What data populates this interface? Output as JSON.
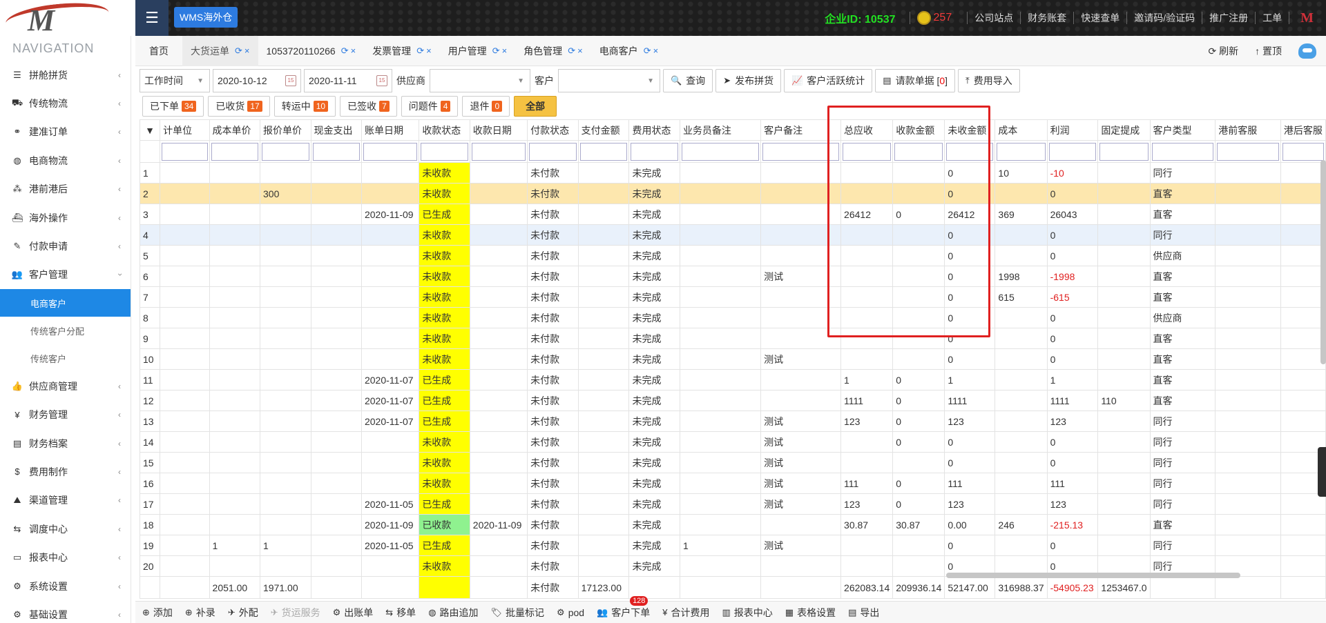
{
  "header": {
    "wms_label": "WMS海外仓",
    "enterprise_label": "企业ID: 10537",
    "coins": "257",
    "links": [
      "公司站点",
      "财务账套",
      "快速查单",
      "邀请码/验证码",
      "推广注册",
      "工单"
    ]
  },
  "sidebar": {
    "title": "NAVIGATION",
    "items": [
      {
        "label": "拼舱拼货",
        "icon": "list-icon"
      },
      {
        "label": "传统物流",
        "icon": "truck-icon"
      },
      {
        "label": "建准订单",
        "icon": "link-icon"
      },
      {
        "label": "电商物流",
        "icon": "globe-icon"
      },
      {
        "label": "港前港后",
        "icon": "cubes-icon"
      },
      {
        "label": "海外操作",
        "icon": "ship-icon"
      },
      {
        "label": "付款申请",
        "icon": "pen-icon"
      },
      {
        "label": "客户管理",
        "icon": "users-icon"
      }
    ],
    "sub_items": [
      "电商客户",
      "传统客户分配",
      "传统客户"
    ],
    "items_after": [
      {
        "label": "供应商管理",
        "icon": "thumb-icon"
      },
      {
        "label": "财务管理",
        "icon": "yen-icon"
      },
      {
        "label": "财务档案",
        "icon": "book-icon"
      },
      {
        "label": "费用制作",
        "icon": "dollar-icon"
      },
      {
        "label": "渠道管理",
        "icon": "road-icon"
      },
      {
        "label": "调度中心",
        "icon": "retweet-icon"
      },
      {
        "label": "报表中心",
        "icon": "file-icon"
      },
      {
        "label": "系统设置",
        "icon": "gear-icon"
      },
      {
        "label": "基础设置",
        "icon": "gear-icon"
      }
    ]
  },
  "tabs": {
    "home": "首页",
    "items": [
      "大货运单",
      "1053720110266",
      "发票管理",
      "用户管理",
      "角色管理",
      "电商客户"
    ],
    "refresh": "刷新",
    "pin": "置顶"
  },
  "toolbar": {
    "time_type": "工作时间",
    "date_from": "2020-10-12",
    "date_to": "2020-11-11",
    "supplier_label": "供应商",
    "customer_label": "客户",
    "query": "查询",
    "publish": "发布拼货",
    "stats": "客户活跃统计",
    "invoice": "请款单据",
    "invoice_count": "0",
    "fee_import": "费用导入"
  },
  "filters": [
    {
      "label": "已下单",
      "count": "34"
    },
    {
      "label": "已收货",
      "count": "17"
    },
    {
      "label": "转运中",
      "count": "10"
    },
    {
      "label": "已签收",
      "count": "7"
    },
    {
      "label": "问题件",
      "count": "4"
    },
    {
      "label": "退件",
      "count": "0"
    }
  ],
  "filter_all": "全部",
  "table": {
    "columns": [
      "计单位",
      "成本单价",
      "报价单价",
      "现金支出",
      "账单日期",
      "收款状态",
      "收款日期",
      "付款状态",
      "支付金额",
      "费用状态",
      "业务员备注",
      "客户备注",
      "总应收",
      "收款金额",
      "未收金额",
      "成本",
      "利润",
      "固定提成",
      "客户类型",
      "港前客服",
      "港后客服"
    ],
    "rows": [
      [
        "",
        "",
        "",
        "",
        "",
        "未收款",
        "",
        "未付款",
        "",
        "未完成",
        "",
        "",
        "",
        "",
        "0",
        "10",
        "-10",
        "",
        "同行",
        "",
        ""
      ],
      [
        "",
        "",
        "300",
        "",
        "",
        "未收款",
        "",
        "未付款",
        "",
        "未完成",
        "",
        "",
        "",
        "",
        "0",
        "",
        "0",
        "",
        "直客",
        "",
        ""
      ],
      [
        "",
        "",
        "",
        "",
        "2020-11-09",
        "已生成",
        "",
        "未付款",
        "",
        "未完成",
        "",
        "",
        "26412",
        "0",
        "26412",
        "369",
        "26043",
        "",
        "直客",
        "",
        ""
      ],
      [
        "",
        "",
        "",
        "",
        "",
        "未收款",
        "",
        "未付款",
        "",
        "未完成",
        "",
        "",
        "",
        "",
        "0",
        "",
        "0",
        "",
        "同行",
        "",
        ""
      ],
      [
        "",
        "",
        "",
        "",
        "",
        "未收款",
        "",
        "未付款",
        "",
        "未完成",
        "",
        "",
        "",
        "",
        "0",
        "",
        "0",
        "",
        "供应商",
        "",
        ""
      ],
      [
        "",
        "",
        "",
        "",
        "",
        "未收款",
        "",
        "未付款",
        "",
        "未完成",
        "",
        "测试",
        "",
        "",
        "0",
        "1998",
        "-1998",
        "",
        "直客",
        "",
        ""
      ],
      [
        "",
        "",
        "",
        "",
        "",
        "未收款",
        "",
        "未付款",
        "",
        "未完成",
        "",
        "",
        "",
        "",
        "0",
        "615",
        "-615",
        "",
        "直客",
        "",
        ""
      ],
      [
        "",
        "",
        "",
        "",
        "",
        "未收款",
        "",
        "未付款",
        "",
        "未完成",
        "",
        "",
        "",
        "",
        "0",
        "",
        "0",
        "",
        "供应商",
        "",
        ""
      ],
      [
        "",
        "",
        "",
        "",
        "",
        "未收款",
        "",
        "未付款",
        "",
        "未完成",
        "",
        "",
        "",
        "",
        "0",
        "",
        "0",
        "",
        "直客",
        "",
        ""
      ],
      [
        "",
        "",
        "",
        "",
        "",
        "未收款",
        "",
        "未付款",
        "",
        "未完成",
        "",
        "测试",
        "",
        "",
        "0",
        "",
        "0",
        "",
        "直客",
        "",
        ""
      ],
      [
        "",
        "",
        "",
        "",
        "2020-11-07",
        "已生成",
        "",
        "未付款",
        "",
        "未完成",
        "",
        "",
        "1",
        "0",
        "1",
        "",
        "1",
        "",
        "直客",
        "",
        ""
      ],
      [
        "",
        "",
        "",
        "",
        "2020-11-07",
        "已生成",
        "",
        "未付款",
        "",
        "未完成",
        "",
        "",
        "1111",
        "0",
        "1111",
        "",
        "1111",
        "110",
        "直客",
        "",
        ""
      ],
      [
        "",
        "",
        "",
        "",
        "2020-11-07",
        "已生成",
        "",
        "未付款",
        "",
        "未完成",
        "",
        "测试",
        "123",
        "0",
        "123",
        "",
        "123",
        "",
        "同行",
        "",
        ""
      ],
      [
        "",
        "",
        "",
        "",
        "",
        "未收款",
        "",
        "未付款",
        "",
        "未完成",
        "",
        "测试",
        "",
        "0",
        "0",
        "",
        "0",
        "",
        "同行",
        "",
        ""
      ],
      [
        "",
        "",
        "",
        "",
        "",
        "未收款",
        "",
        "未付款",
        "",
        "未完成",
        "",
        "测试",
        "",
        "",
        "0",
        "",
        "0",
        "",
        "同行",
        "",
        ""
      ],
      [
        "",
        "",
        "",
        "",
        "",
        "未收款",
        "",
        "未付款",
        "",
        "未完成",
        "",
        "测试",
        "111",
        "0",
        "111",
        "",
        "111",
        "",
        "同行",
        "",
        ""
      ],
      [
        "",
        "",
        "",
        "",
        "2020-11-05",
        "已生成",
        "",
        "未付款",
        "",
        "未完成",
        "",
        "测试",
        "123",
        "0",
        "123",
        "",
        "123",
        "",
        "同行",
        "",
        ""
      ],
      [
        "",
        "",
        "",
        "",
        "2020-11-09",
        "已收款",
        "2020-11-09",
        "未付款",
        "",
        "未完成",
        "",
        "",
        "30.87",
        "30.87",
        "0.00",
        "246",
        "-215.13",
        "",
        "直客",
        "",
        ""
      ],
      [
        "",
        "1",
        "1",
        "",
        "2020-11-05",
        "已生成",
        "",
        "未付款",
        "",
        "未完成",
        "1",
        "测试",
        "",
        "",
        "0",
        "",
        "0",
        "",
        "同行",
        "",
        ""
      ],
      [
        "",
        "",
        "",
        "",
        "",
        "未收款",
        "",
        "未付款",
        "",
        "未完成",
        "",
        "",
        "",
        "",
        "0",
        "",
        "0",
        "",
        "同行",
        "",
        ""
      ]
    ],
    "summary": [
      "",
      "2051.00",
      "1971.00",
      "",
      "",
      "",
      "",
      "未付款",
      "17123.00",
      "",
      "",
      "",
      "262083.14",
      "209936.14",
      "52147.00",
      "316988.37",
      "-54905.23",
      "1253467.0",
      "",
      "",
      ""
    ]
  },
  "bottom": {
    "items": [
      {
        "label": "添加",
        "icon": "plus-circle-icon"
      },
      {
        "label": "补录",
        "icon": "plus-circle-icon"
      },
      {
        "label": "外配",
        "icon": "plane-icon"
      },
      {
        "label": "货运服务",
        "icon": "plane-icon",
        "disabled": true
      },
      {
        "label": "出账单",
        "icon": "gear-icon"
      },
      {
        "label": "移单",
        "icon": "retweet-icon"
      },
      {
        "label": "路由追加",
        "icon": "globe-icon"
      },
      {
        "label": "批量标记",
        "icon": "tag-icon"
      },
      {
        "label": "pod",
        "icon": "gear-icon"
      },
      {
        "label": "客户下单",
        "icon": "users-icon",
        "badge": "128"
      },
      {
        "label": "合计费用",
        "icon": "yen-icon"
      },
      {
        "label": "报表中心",
        "icon": "chart-icon"
      },
      {
        "label": "表格设置",
        "icon": "table-icon"
      },
      {
        "label": "导出",
        "icon": "file-icon"
      }
    ]
  }
}
